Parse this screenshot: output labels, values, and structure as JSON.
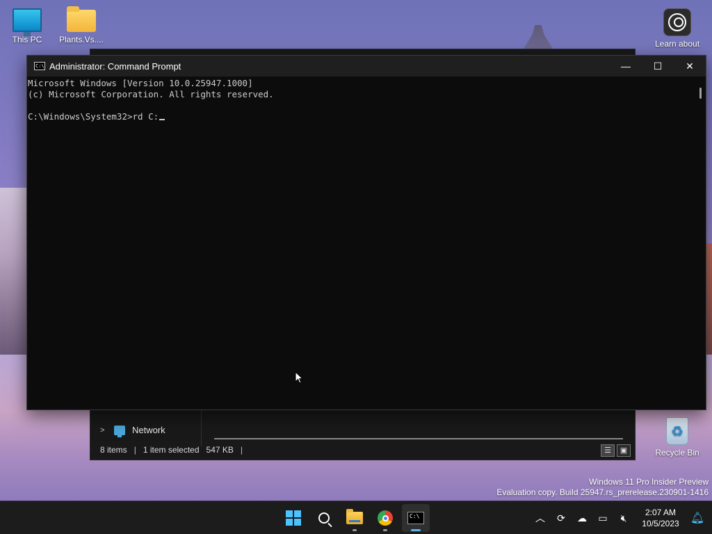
{
  "desktop": {
    "icons": [
      {
        "label": "This PC"
      },
      {
        "label": "Plants.Vs...."
      },
      {
        "label": "Learn about"
      },
      {
        "label": "Recycle Bin"
      }
    ]
  },
  "explorer": {
    "nav_network_label": "Network",
    "status": {
      "items": "8 items",
      "selected": "1 item selected",
      "size": "547 KB"
    }
  },
  "cmd": {
    "title": "Administrator: Command Prompt",
    "lines": [
      "Microsoft Windows [Version 10.0.25947.1000]",
      "(c) Microsoft Corporation. All rights reserved.",
      "",
      "C:\\Windows\\System32>rd C:"
    ],
    "controls": {
      "minimize": "—",
      "maximize": "☐",
      "close": "✕"
    }
  },
  "watermark": {
    "line1": "Windows 11 Pro Insider Preview",
    "line2": "Evaluation copy. Build 25947.rs_prerelease.230901-1416"
  },
  "taskbar": {
    "apps": [
      "start-icon",
      "search-icon",
      "file-explorer-icon",
      "chrome-icon",
      "terminal-icon"
    ],
    "tray": {
      "time": "2:07 AM",
      "date": "10/5/2023"
    }
  }
}
